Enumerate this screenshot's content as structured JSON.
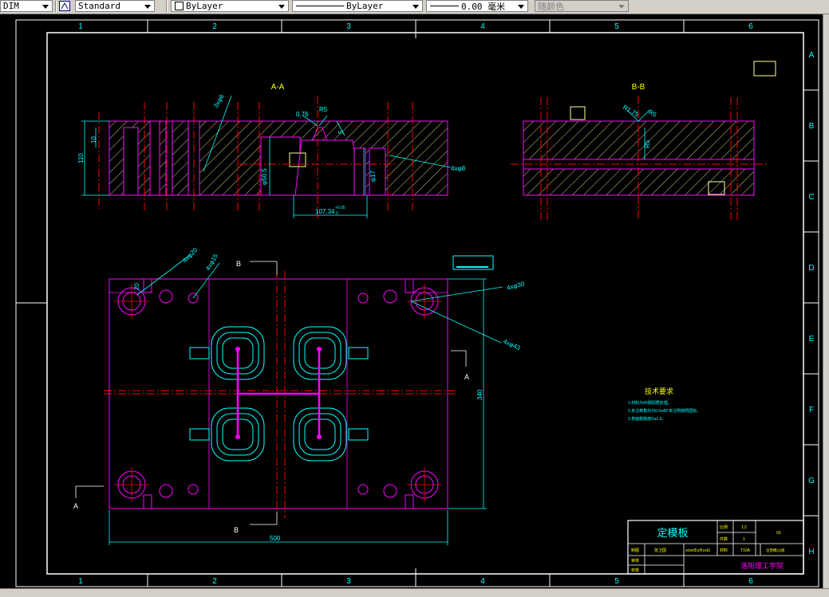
{
  "toolbar": {
    "dimstyle": "DIM",
    "textstyle": "Standard",
    "layer_color": "ByLayer",
    "linetype": "ByLayer",
    "lineweight": "0.00 毫米",
    "plotstyle": "随颜色"
  },
  "drawing": {
    "border_cols": [
      "1",
      "2",
      "3",
      "4",
      "5",
      "6"
    ],
    "border_rows": [
      "A",
      "B",
      "C",
      "D",
      "E",
      "F",
      "G",
      "H"
    ],
    "section_aa_label": "A-A",
    "section_bb_label": "B-B",
    "aa_dims": {
      "height_110": "110",
      "dim_10": "10",
      "screw": "3xφ6",
      "angle1": "0.76",
      "r5": "R5",
      "dim_5": "5",
      "h_vert": "φ50.5",
      "width_107": "107.34",
      "tol": "+0.05",
      "tol0": "0",
      "hole_4x8": "4xφ8",
      "right_vert": "φ17"
    },
    "bb_dims": {
      "r1": "R1.75",
      "r2": "R5",
      "vert": "R5"
    },
    "plan": {
      "label_b_top": "B",
      "label_b_bottom": "B",
      "label_a_left": "A",
      "label_a_right": "A",
      "dim_20": "20",
      "hole_4x20": "4xφ20",
      "hole_4x15": "4xφ15",
      "hole_4x30": "4xφ30",
      "hole_4x43": "4xφ43",
      "width_500": "500",
      "height_340": "340"
    },
    "tech_req": {
      "title": "技术要求",
      "items": [
        "1.材料为45钢调质处理。",
        "2.未注倒角均为0.5x45°未注明按照国标。",
        "3.表面粗糙度Ra1.6。"
      ]
    },
    "title_block": {
      "part_name": "定模板",
      "scale_label": "比例",
      "scale_value": "1:2",
      "qty_label": "件数",
      "qty_value": "1",
      "drawing_no": "03",
      "designer_label": "制图",
      "designer_name": "张卫国",
      "date": "2008年5月19日",
      "material_label": "材料",
      "material_value": "T10A",
      "project": "注塑模(1)组",
      "reviewer_label": "审核",
      "school": "洛阳理工学院",
      "check_label": "校核"
    }
  },
  "colors": {
    "magenta": "#ff00ff",
    "cyan": "#00ffff",
    "red": "#ff0000",
    "white": "#ffffff",
    "yellow_hatch": "#ffff99"
  }
}
